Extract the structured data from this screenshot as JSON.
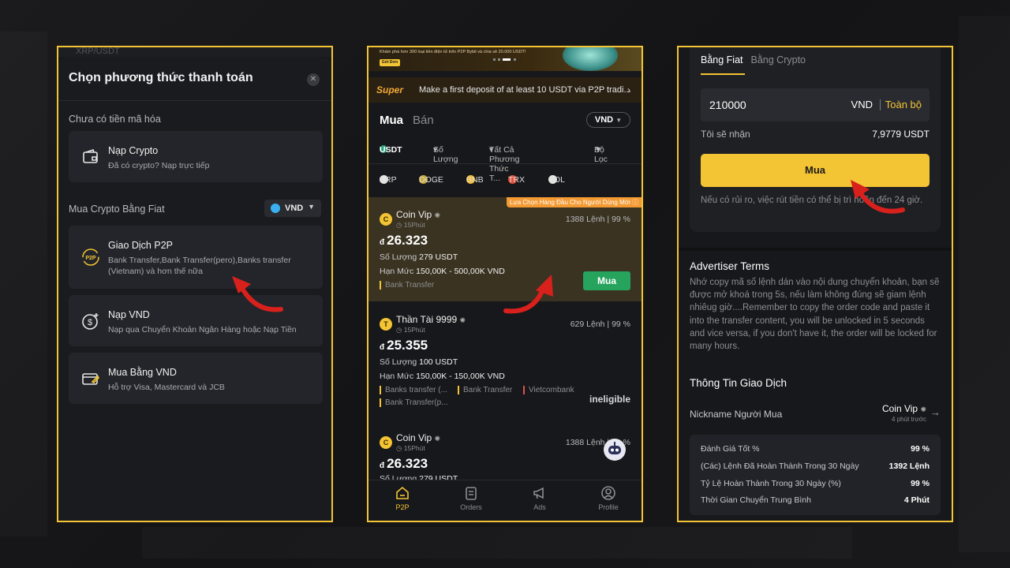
{
  "left_panel": {
    "top_search_hint": "XRP/USDT",
    "title": "Chọn phương thức thanh toán",
    "section_no_crypto": "Chưa có tiền mã hóa",
    "deposit_crypto": {
      "title": "Nạp Crypto",
      "desc": "Đã có crypto? Nạp trực tiếp"
    },
    "section_fiat": "Mua Crypto Bằng Fiat",
    "currency": "VND",
    "p2p": {
      "title": "Giao Dịch P2P",
      "desc": "Bank Transfer,Bank Transfer(pero),Banks transfer (Vietnam) và hơn thế nữa",
      "icon_text": "P2P"
    },
    "deposit_vnd": {
      "title": "Nạp VND",
      "desc": "Nạp qua Chuyển Khoản Ngân Hàng hoặc Nạp Tiền"
    },
    "buy_vnd": {
      "title": "Mua Bằng VND",
      "desc": "Hỗ trợ Visa, Mastercard và JCB"
    }
  },
  "middle_panel": {
    "banner_text": "Khám phá hơn 300 loại tiền điện tử trên P2P Bybit và chia sẻ 20.000 USDT!",
    "banner_button": "Gửi Đơn",
    "super_logo": "Super",
    "super_text": "Make a first deposit of at least 10 USDT via P2P tradi...",
    "tab_buy": "Mua",
    "tab_sell": "Bán",
    "currency": "VND",
    "filters": {
      "coin": "USDT",
      "amount": "Số Lượng",
      "payment": "Tất Cả Phương Thức T...",
      "filter": "Bộ Lọc"
    },
    "coins": [
      "XRP",
      "DOGE",
      "BNB",
      "TRX",
      "SOL"
    ],
    "coin_colors": [
      "#e6e6e6",
      "#c9a93a",
      "#f3ba2f",
      "#e0503a",
      "#e6e6e6"
    ],
    "ads": [
      {
        "badge": "Lựa Chọn Hàng Đầu Cho Người Dùng Mới",
        "avatar": "C",
        "name": "Coin Vip",
        "time": "15Phút",
        "orders": "1388 Lệnh",
        "rate": "99 %",
        "currency_symbol": "đ",
        "price": "26.323",
        "qty_label": "Số Lượng",
        "qty": "279 USDT",
        "limit_label": "Hạn Mức",
        "limit": "150,00K - 500,00K VND",
        "payments": [
          "Bank Transfer"
        ],
        "action": "Mua"
      },
      {
        "avatar": "T",
        "name": "Thần Tài 9999",
        "time": "15Phút",
        "orders": "629 Lệnh",
        "rate": "99 %",
        "currency_symbol": "đ",
        "price": "25.355",
        "qty_label": "Số Lượng",
        "qty": "100 USDT",
        "limit_label": "Hạn Mức",
        "limit": "150,00K - 150,00K VND",
        "payments": [
          "Banks transfer (...",
          "Bank Transfer",
          "Vietcombank",
          "Bank Transfer(p..."
        ],
        "action": "ineligible"
      },
      {
        "avatar": "C",
        "name": "Coin Vip",
        "time": "15Phút",
        "orders": "1388 Lệnh",
        "rate": "99 %",
        "currency_symbol": "đ",
        "price": "26.323",
        "qty_label": "Số Lượng",
        "qty": "279 USDT"
      }
    ],
    "nav": [
      "P2P",
      "Orders",
      "Ads",
      "Profile"
    ]
  },
  "right_panel": {
    "tab_fiat": "Bằng Fiat",
    "tab_crypto": "Bằng Crypto",
    "amount": "210000",
    "amount_currency": "VND",
    "all_label": "Toàn bộ",
    "receive_label": "Tôi sẽ nhận",
    "receive_value": "7,9779 USDT",
    "buy_button": "Mua",
    "warning": "Nếu có rủi ro, việc rút tiền có thể bị trì hoãn đến 24 giờ.",
    "terms_title": "Advertiser Terms",
    "terms_text": "Nhớ copy mã số lệnh dán vào nội dung chuyển khoản, bạn sẽ được mở khoá trong 5s, nếu làm không đúng sẽ giam lệnh nhiêug giờ....Remember to copy the order code and paste it into the transfer content, you will be unlocked in 5 seconds and vice versa, if you don't have it, the order will be locked for many hours.",
    "info_title": "Thông Tin Giao Dịch",
    "nickname_label": "Nickname Người Mua",
    "nickname_value": "Coin Vip",
    "nickname_time": "4 phút trước",
    "stats": [
      {
        "label": "Đánh Giá Tốt %",
        "value": "99 %"
      },
      {
        "label": "(Các) Lệnh Đã Hoàn Thành Trong 30 Ngày",
        "value": "1392 Lệnh"
      },
      {
        "label": "Tỷ Lệ Hoàn Thành Trong 30 Ngày (%)",
        "value": "99 %"
      },
      {
        "label": "Thời Gian Chuyển Trung Bình",
        "value": "4 Phút"
      }
    ]
  },
  "colors": {
    "accent": "#f3c433",
    "buy_green": "#26a35d",
    "arrow_red": "#d8201c",
    "panel_border": "#f3c433"
  }
}
